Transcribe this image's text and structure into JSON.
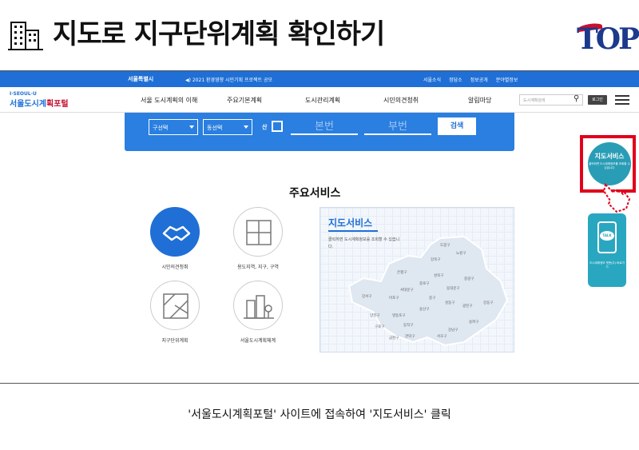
{
  "slide": {
    "title": "지도로 지구단위계획 확인하기",
    "caption": "'서울도시계획포털' 사이트에 접속하여 '지도서비스' 클릭",
    "logo": "TOP"
  },
  "topbar": {
    "seoul": "서울특별시",
    "notice": "◀) 2021 환경영향 시민기획 프로젝트 공모",
    "links": [
      "서울소식",
      "정담소",
      "정보공개",
      "분야별정보"
    ]
  },
  "navbar": {
    "brand_sub": "I·SEOUL·U",
    "brand_main_a": "서울도시계",
    "brand_main_b": "획포털",
    "menu": [
      "서울 도시계획의 이해",
      "주요기본계획",
      "도시관리계획",
      "시민의견청취",
      "알림마당"
    ],
    "search_placeholder": "도시계획검색",
    "login": "로그인"
  },
  "search_panel": {
    "gu": "구선택",
    "dong": "동선택",
    "san": "산",
    "bonbeon": "본번",
    "bubeon": "부번",
    "search": "검색"
  },
  "services": {
    "title": "주요서비스",
    "items": [
      {
        "label": "시민의견청취"
      },
      {
        "label": "용도지역, 지구, 구역"
      },
      {
        "label": "지구단위계획"
      },
      {
        "label": "서울도시계획체계"
      }
    ]
  },
  "map_service": {
    "title": "지도서비스",
    "desc": "클릭하면 도시계획정보를 조회할 수 있습니다.",
    "districts": [
      "도봉구",
      "노원구",
      "강북구",
      "은평구",
      "성북구",
      "중랑구",
      "종로구",
      "동대문구",
      "서대문구",
      "강서구",
      "마포구",
      "중구",
      "성동구",
      "광진구",
      "강동구",
      "용산구",
      "양천구",
      "영등포구",
      "동작구",
      "송파구",
      "구로구",
      "강남구",
      "금천구",
      "관악구",
      "서초구"
    ]
  },
  "widgets": {
    "map_title": "지도서비스",
    "map_sub": "클릭하면 도시계획정보를 조회할 수 있습니다",
    "talk": "TALK",
    "talk_label": "도시계획정보 챗봇(주) 바로가기"
  }
}
